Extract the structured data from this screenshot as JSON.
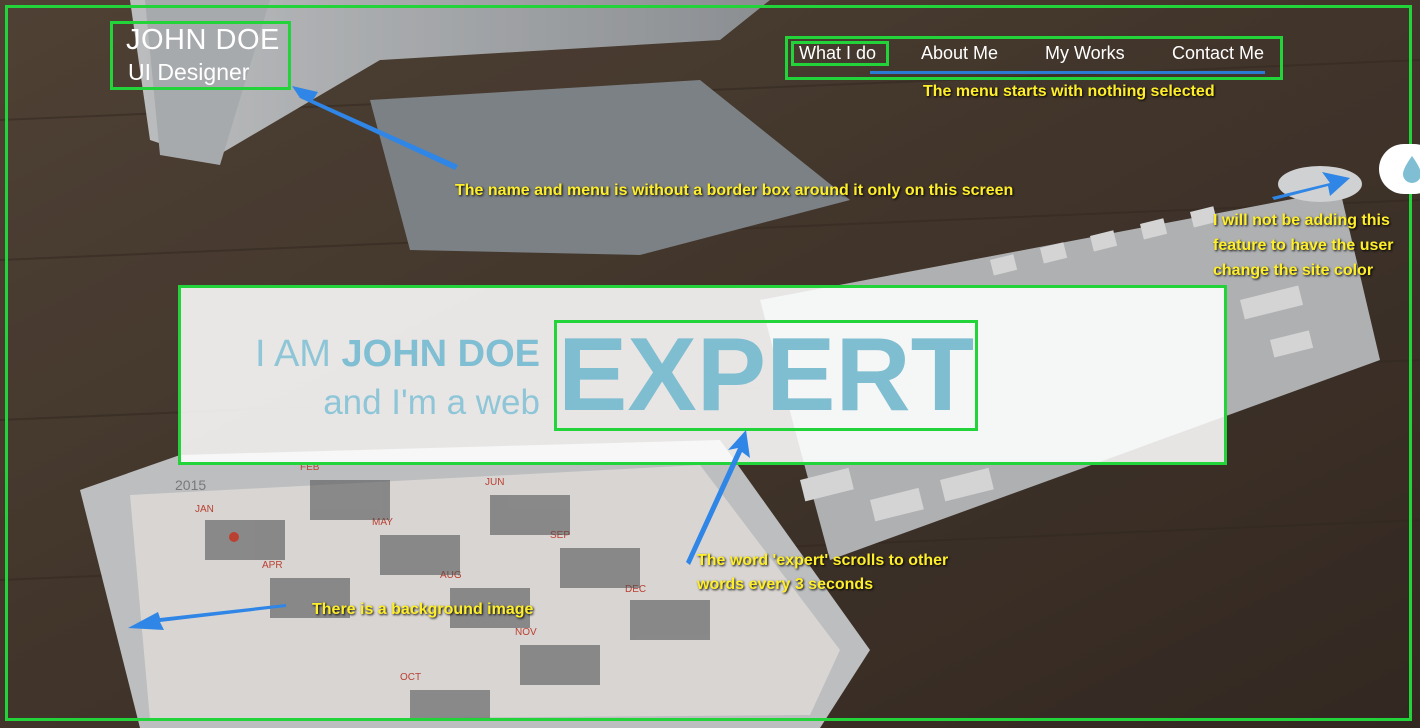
{
  "brand": {
    "name": "JOHN DOE",
    "role": "UI Designer"
  },
  "menu": {
    "items": [
      "What I do",
      "About Me",
      "My Works",
      "Contact Me"
    ]
  },
  "hero": {
    "line1_prefix": "I AM ",
    "line1_name": "JOHN DOE",
    "line2": "and I'm a web",
    "rotating_word": "EXPERT"
  },
  "annotations": {
    "menu_note": "The menu starts with nothing selected",
    "brand_note": "The name and menu is without a border box around it only on this screen",
    "color_note_1": "I will not be adding this",
    "color_note_2": "feature to have the user",
    "color_note_3": "change the site color",
    "expert_note_1": "The word 'expert' scrolls to other",
    "expert_note_2": "words every 3 seconds",
    "bg_note": "There is a background image"
  },
  "icons": {
    "color_toggle": "water-drop-icon"
  },
  "colors": {
    "accent": "#7fbed3",
    "annotation": "#ffef2a",
    "outline": "#22d33a",
    "arrow": "#2f86e6"
  }
}
